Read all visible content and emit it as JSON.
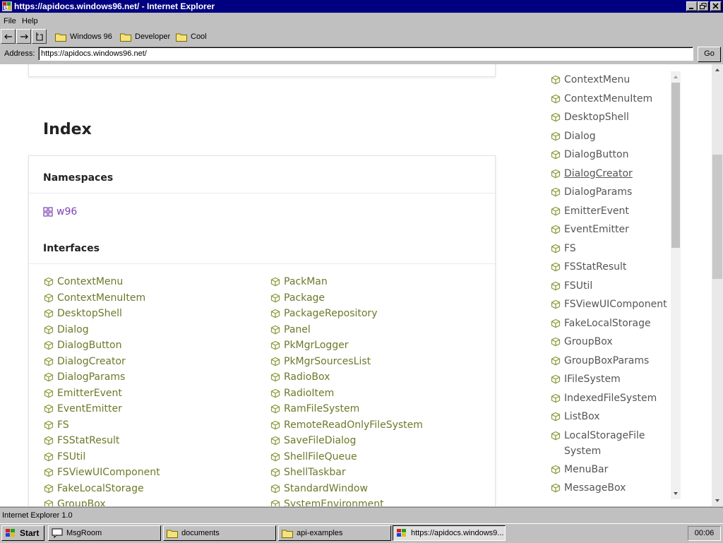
{
  "window": {
    "title": "https://apidocs.windows96.net/ - Internet Explorer"
  },
  "menu": [
    "File",
    "Help"
  ],
  "favorites": [
    "Windows 96",
    "Developer",
    "Cool"
  ],
  "address": {
    "label": "Address:",
    "value": "https://apidocs.windows96.net/",
    "go_label": "Go"
  },
  "page": {
    "heading": "Index",
    "namespaces_title": "Namespaces",
    "namespace": "w96",
    "interfaces_title": "Interfaces",
    "interfaces_col1": [
      "ContextMenu",
      "ContextMenuItem",
      "DesktopShell",
      "Dialog",
      "DialogButton",
      "DialogCreator",
      "DialogParams",
      "EmitterEvent",
      "EventEmitter",
      "FS",
      "FSStatResult",
      "FSUtil",
      "FSViewUIComponent",
      "FakeLocalStorage",
      "GroupBox"
    ],
    "interfaces_col2": [
      "PackMan",
      "Package",
      "PackageRepository",
      "Panel",
      "PkMgrLogger",
      "PkMgrSourcesList",
      "RadioBox",
      "RadioItem",
      "RamFileSystem",
      "RemoteReadOnlyFileSystem",
      "SaveFileDialog",
      "ShellFileQueue",
      "ShellTaskbar",
      "StandardWindow",
      "SystemEnvironment"
    ]
  },
  "sidebar": {
    "items": [
      "ContextMenu",
      "ContextMenuItem",
      "DesktopShell",
      "Dialog",
      "DialogButton",
      "DialogCreator",
      "DialogParams",
      "EmitterEvent",
      "EventEmitter",
      "FS",
      "FSStatResult",
      "FSUtil",
      "FSViewUIComponent",
      "FakeLocalStorage",
      "GroupBox",
      "GroupBoxParams",
      "IFileSystem",
      "IndexedFileSystem",
      "ListBox",
      "LocalStorageFile System",
      "MenuBar",
      "MessageBox"
    ]
  },
  "status": {
    "text": "Internet Explorer 1.0"
  },
  "taskbar": {
    "start_label": "Start",
    "items": [
      "MsgRoom",
      "documents",
      "api-examples",
      "https://apidocs.windows9..."
    ],
    "clock": "00:06"
  },
  "colors": {
    "title_bar": "#000080",
    "link": "#6b7a2a",
    "namespace_link": "#7b3fb5",
    "chrome": "#c0c0c0"
  },
  "icons": {
    "interface": "cube-outline-icon",
    "namespace": "cubes-icon",
    "folder": "folder-icon"
  }
}
